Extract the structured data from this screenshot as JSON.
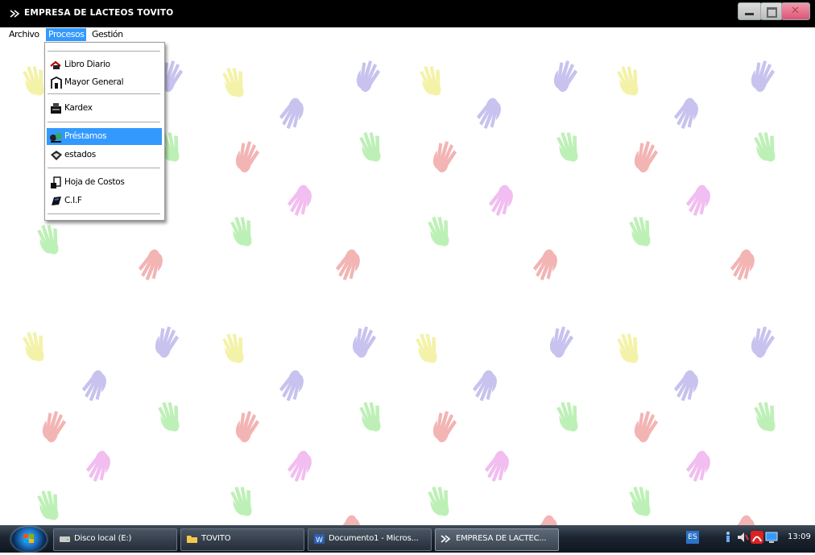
{
  "window": {
    "title": "EMPRESA DE LACTEOS TOVITO"
  },
  "menubar": {
    "items": [
      "Archivo",
      "Procesos",
      "Gestión"
    ],
    "active_index": 1
  },
  "dropdown": {
    "items": [
      {
        "label": "Libro Diario",
        "icon": "journal-icon"
      },
      {
        "label": "Mayor General",
        "icon": "ledger-icon"
      },
      {
        "label": "Kardex",
        "icon": "kardex-icon"
      },
      {
        "label": "Préstamos",
        "icon": "loan-icon",
        "highlighted": true
      },
      {
        "label": "estados",
        "icon": "statements-icon"
      },
      {
        "label": "Hoja de Costos",
        "icon": "cost-sheet-icon"
      },
      {
        "label": "C.I.F",
        "icon": "cif-icon"
      }
    ]
  },
  "taskbar": {
    "tasks": [
      {
        "label": "Disco local (E:)",
        "icon": "drive-icon"
      },
      {
        "label": "TOVITO",
        "icon": "folder-icon"
      },
      {
        "label": "Documento1 - Micros...",
        "icon": "word-icon"
      },
      {
        "label": "EMPRESA DE LACTEC...",
        "icon": "app-icon",
        "active": true
      }
    ],
    "language": "ES",
    "clock": "13:09"
  },
  "colors": {
    "menu_highlight": "#3399ff",
    "hand_yellow": "#f3f2a8",
    "hand_lilac": "#c7c2ee",
    "hand_green": "#bdf0b6",
    "hand_red": "#f3b4b4",
    "hand_pink": "#f2bdf0"
  }
}
